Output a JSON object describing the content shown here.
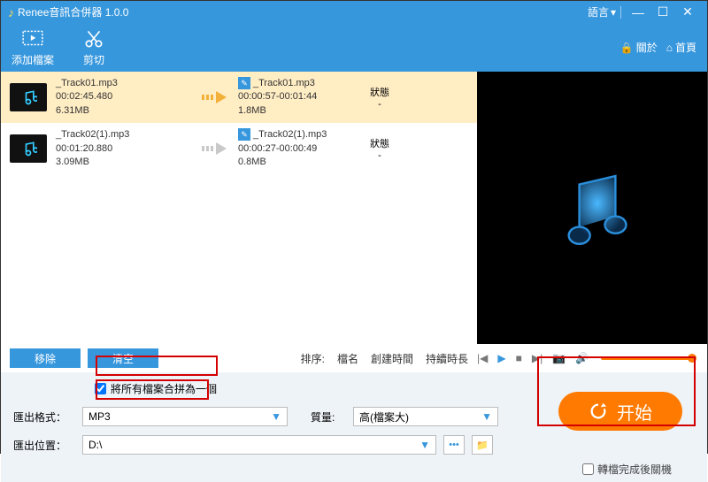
{
  "title": "Renee音訊合併器 1.0.0",
  "lang_label": "語言",
  "about_label": "關於",
  "home_label": "首頁",
  "toolbar": {
    "add": "添加檔案",
    "cut": "剪切"
  },
  "tracks": [
    {
      "name": "_Track01.mp3",
      "dur": "00:02:45.480",
      "size": "6.31MB",
      "out_name": "_Track01.mp3",
      "out_range": "00:00:57-00:01:44",
      "out_size": "1.8MB",
      "status": "-",
      "selected": true
    },
    {
      "name": "_Track02(1).mp3",
      "dur": "00:01:20.880",
      "size": "3.09MB",
      "out_name": "_Track02(1).mp3",
      "out_range": "00:00:27-00:00:49",
      "out_size": "0.8MB",
      "status": "-",
      "selected": false
    }
  ],
  "status_header": "狀態",
  "btn": {
    "remove": "移除",
    "clear": "清空"
  },
  "sort": {
    "label": "排序:",
    "name": "檔名",
    "time": "創建時間",
    "dur": "持續時長"
  },
  "merge_label": "將所有檔案合拼為一個",
  "format_label": "匯出格式：",
  "format_value": "MP3",
  "quality_label": "質量:",
  "quality_value": "高(檔案大)",
  "output_label": "匯出位置：",
  "output_value": "D:\\",
  "start_label": "开始",
  "convert_done_label": "轉檔完成後關機"
}
